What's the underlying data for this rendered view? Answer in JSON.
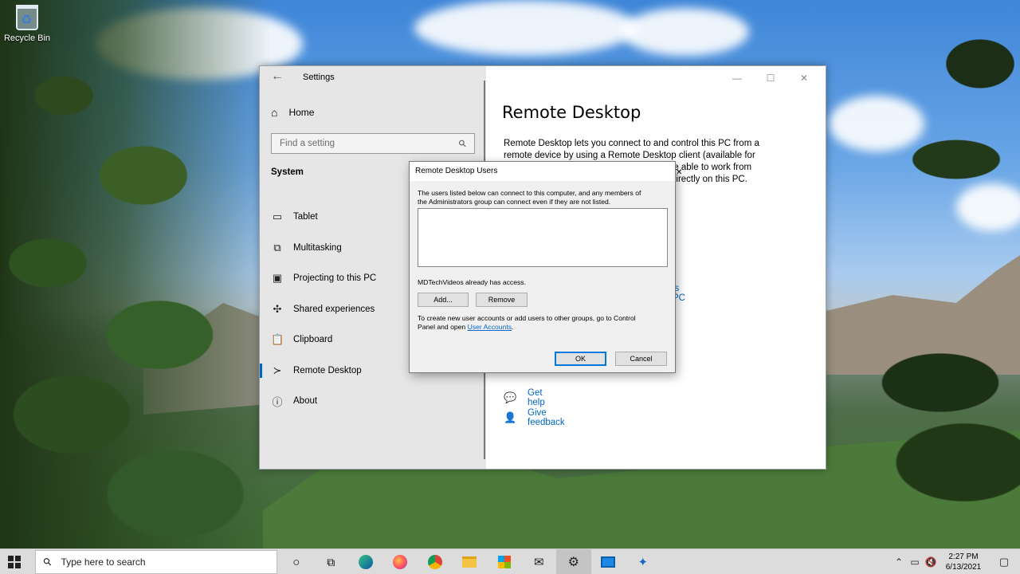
{
  "desktop": {
    "icons": [
      {
        "label": "Recycle Bin",
        "icon": "recycle-bin-icon"
      }
    ]
  },
  "settings": {
    "app_title": "Settings",
    "home_label": "Home",
    "search_placeholder": "Find a setting",
    "section_label": "System",
    "nav_items": [
      {
        "label": "Tablet",
        "icon": "tablet-icon"
      },
      {
        "label": "Multitasking",
        "icon": "multitasking-icon"
      },
      {
        "label": "Projecting to this PC",
        "icon": "projecting-icon"
      },
      {
        "label": "Shared experiences",
        "icon": "shared-experiences-icon"
      },
      {
        "label": "Clipboard",
        "icon": "clipboard-icon"
      },
      {
        "label": "Remote Desktop",
        "icon": "remote-desktop-icon",
        "active": true
      },
      {
        "label": "About",
        "icon": "about-icon"
      }
    ],
    "page_title": "Remote Desktop",
    "page_description_lines": [
      "Remote Desktop lets you connect to and control this PC from a",
      "remote device by using a Remote Desktop client (available for",
      "u'll be able to work from",
      "directly on this PC."
    ],
    "partial_link": "is PC",
    "help_links": [
      {
        "label": "Get help",
        "icon": "get-help-icon"
      },
      {
        "label": "Give feedback",
        "icon": "give-feedback-icon"
      }
    ]
  },
  "dialog": {
    "title": "Remote Desktop Users",
    "intro_line1": "The users listed below can connect to this computer, and any members of",
    "intro_line2": "the Administrators group can connect even if they are not listed.",
    "access_text": "MDTechVideos already has access.",
    "add_label": "Add...",
    "remove_label": "Remove",
    "footer_line1": "To create new user accounts or add users to other groups, go to Control",
    "footer_line2_prefix": "Panel and open ",
    "footer_link": "User Accounts",
    "footer_line2_suffix": ".",
    "ok_label": "OK",
    "cancel_label": "Cancel"
  },
  "taskbar": {
    "search_placeholder": "Type here to search",
    "apps": [
      {
        "name": "cortana-icon"
      },
      {
        "name": "task-view-icon"
      },
      {
        "name": "edge-icon"
      },
      {
        "name": "firefox-icon"
      },
      {
        "name": "chrome-icon"
      },
      {
        "name": "file-explorer-icon"
      },
      {
        "name": "store-icon"
      },
      {
        "name": "mail-icon"
      },
      {
        "name": "settings-icon",
        "active": true
      },
      {
        "name": "remote-desktop-app-icon"
      },
      {
        "name": "azure-icon"
      }
    ],
    "time": "2:27 PM",
    "date": "6/13/2021"
  }
}
